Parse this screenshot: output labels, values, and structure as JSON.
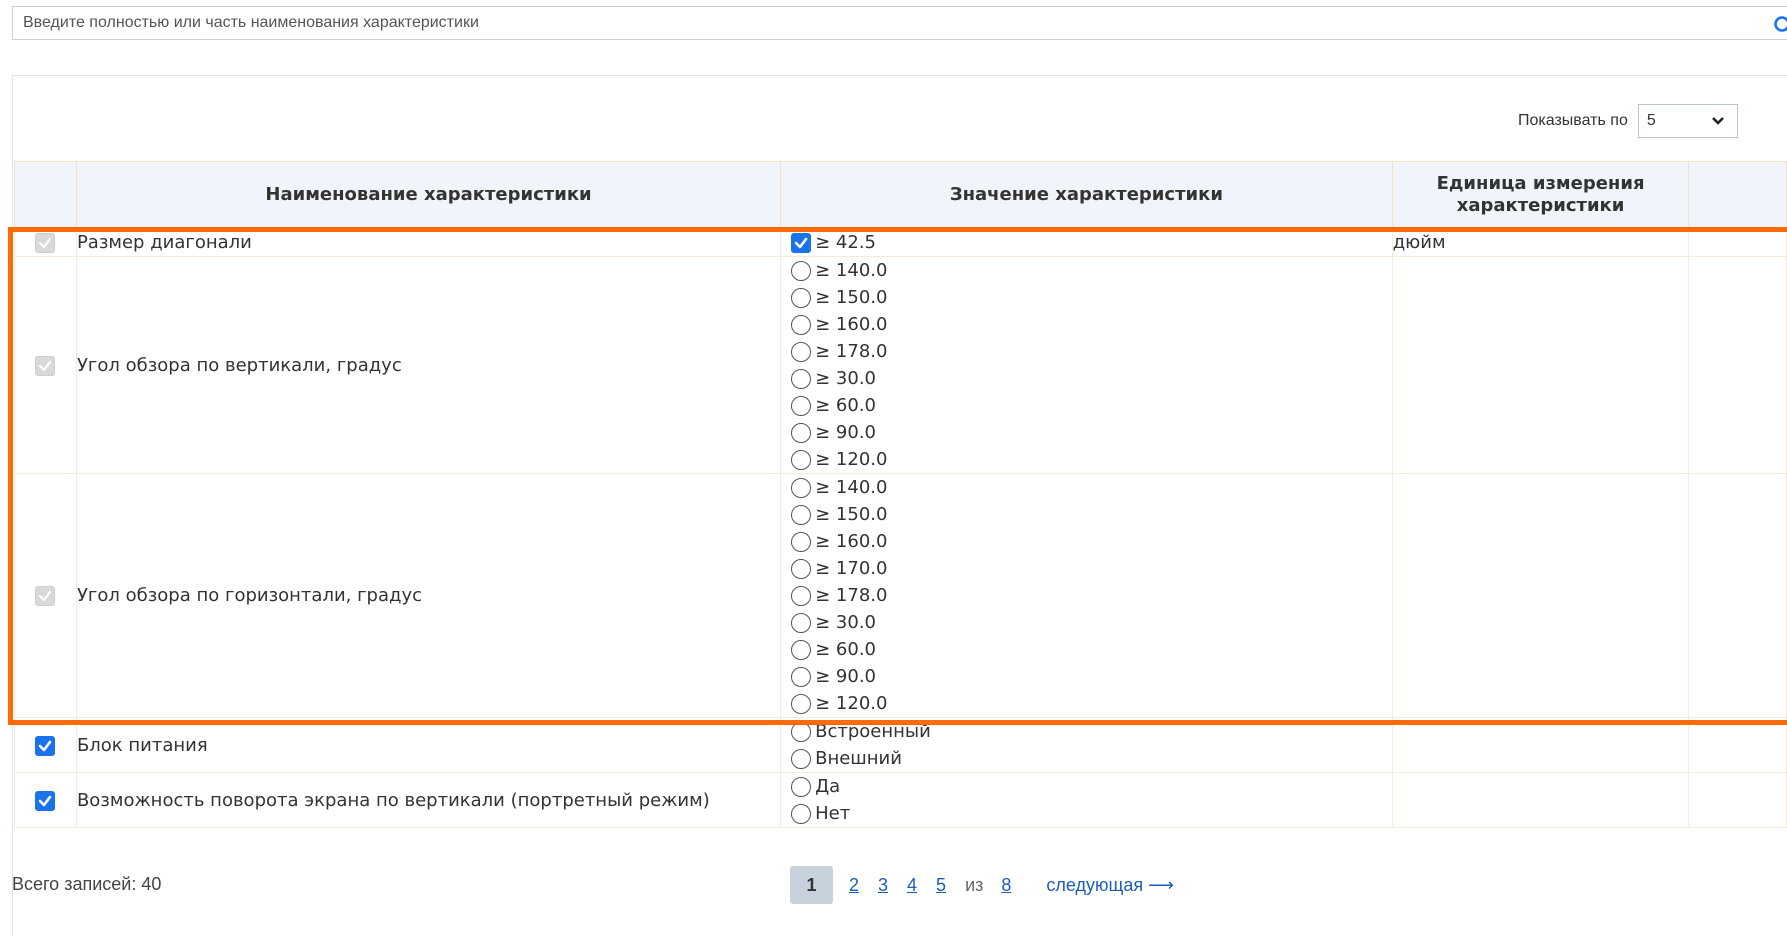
{
  "search": {
    "placeholder": "Введите полностью или часть наименования характеристики",
    "icon": "search-icon",
    "accent": "#1a73e8"
  },
  "page_size": {
    "label": "Показывать по",
    "value": "5"
  },
  "table": {
    "headers": [
      "Наименование характеристики",
      "Значение характеристики",
      "Единица измерения характеристики"
    ],
    "rows": [
      {
        "name": "Размер диагонали",
        "row_checked": true,
        "row_disabled": true,
        "option_type": "checkbox",
        "options": [
          {
            "label": "≥ 42.5",
            "checked": true
          }
        ],
        "unit": "дюйм"
      },
      {
        "name": "Угол обзора по вертикали, градус",
        "row_checked": true,
        "row_disabled": true,
        "option_type": "radio",
        "options": [
          {
            "label": "≥ 140.0"
          },
          {
            "label": "≥ 150.0"
          },
          {
            "label": "≥ 160.0"
          },
          {
            "label": "≥ 178.0"
          },
          {
            "label": "≥ 30.0"
          },
          {
            "label": "≥ 60.0"
          },
          {
            "label": "≥ 90.0"
          },
          {
            "label": "≥ 120.0"
          }
        ],
        "unit": ""
      },
      {
        "name": "Угол обзора по горизонтали, градус",
        "row_checked": true,
        "row_disabled": true,
        "option_type": "radio",
        "options": [
          {
            "label": "≥ 140.0"
          },
          {
            "label": "≥ 150.0"
          },
          {
            "label": "≥ 160.0"
          },
          {
            "label": "≥ 170.0"
          },
          {
            "label": "≥ 178.0"
          },
          {
            "label": "≥ 30.0"
          },
          {
            "label": "≥ 60.0"
          },
          {
            "label": "≥ 90.0"
          },
          {
            "label": "≥ 120.0"
          }
        ],
        "unit": ""
      },
      {
        "name": "Блок питания",
        "row_checked": true,
        "row_disabled": false,
        "option_type": "radio",
        "options": [
          {
            "label": "Встроенный"
          },
          {
            "label": "Внешний"
          }
        ],
        "unit": ""
      },
      {
        "name": "Возможность поворота экрана по вертикали (портретный режим)",
        "row_checked": true,
        "row_disabled": false,
        "option_type": "radio",
        "options": [
          {
            "label": "Да"
          },
          {
            "label": "Нет"
          }
        ],
        "unit": ""
      }
    ]
  },
  "footer": {
    "total": "Всего записей: 40",
    "pager": {
      "current": "1",
      "pages": [
        "2",
        "3",
        "4",
        "5"
      ],
      "of_label": "из",
      "last": "8",
      "next_label": "следующая ⟶"
    }
  },
  "colors": {
    "highlight": "#ff6a00",
    "header_bg": "#eff5fb",
    "link": "#1a5fb4"
  }
}
